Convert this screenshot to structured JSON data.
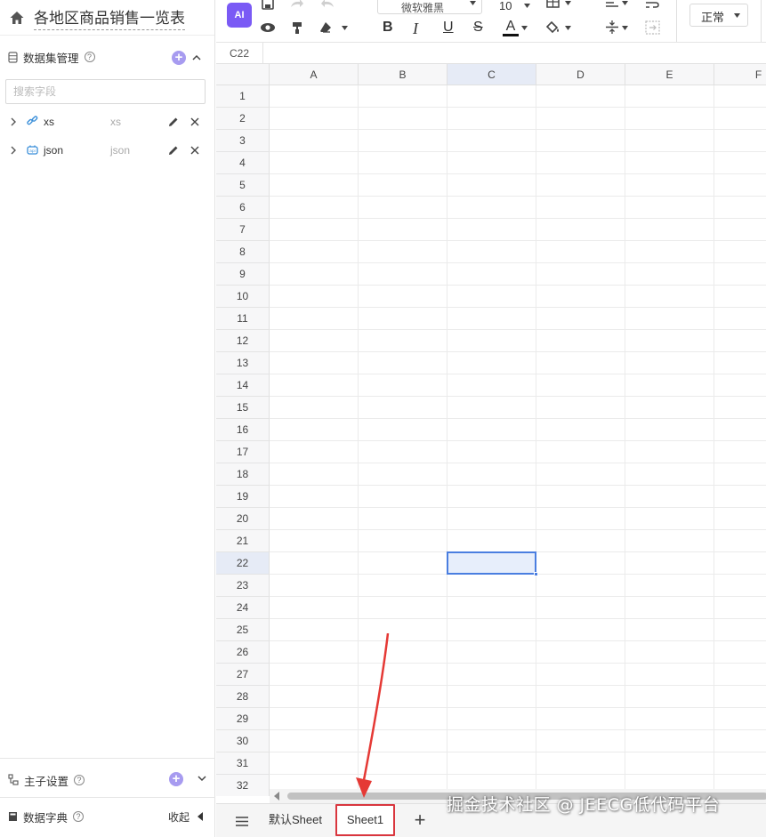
{
  "sidebar": {
    "title": "各地区商品销售一览表",
    "dataset_section": {
      "label": "数据集管理",
      "help": "?"
    },
    "search": {
      "placeholder": "搜索字段"
    },
    "datasets": [
      {
        "name": "xs",
        "type": "xs",
        "icon": "link-icon"
      },
      {
        "name": "json",
        "type": "json",
        "icon": "api-icon"
      }
    ],
    "main_sub": {
      "label": "主子设置",
      "help": "?"
    },
    "dictionary": {
      "label": "数据字典",
      "help": "?",
      "collapse_label": "收起"
    }
  },
  "toolbar": {
    "ai_label": "AI",
    "font_family": "微软雅黑",
    "font_size": "10",
    "bold": "B",
    "italic": "I",
    "underline": "U",
    "strike": "S",
    "font_color_letter": "A",
    "number_format": "正常"
  },
  "namebar": {
    "cell": "C22"
  },
  "grid": {
    "columns": [
      "A",
      "B",
      "C",
      "D",
      "E",
      "F"
    ],
    "rows": [
      "1",
      "2",
      "3",
      "4",
      "5",
      "6",
      "7",
      "8",
      "9",
      "10",
      "11",
      "12",
      "13",
      "14",
      "15",
      "16",
      "17",
      "18",
      "19",
      "20",
      "21",
      "22",
      "23",
      "24",
      "25",
      "26",
      "27",
      "28",
      "29",
      "30",
      "31",
      "32"
    ],
    "active_column": "C",
    "active_row": "22"
  },
  "tabs": {
    "items": [
      "默认Sheet",
      "Sheet1"
    ],
    "active": "Sheet1",
    "add": "+"
  },
  "watermark": "掘金技术社区 @ JEECG低代码平台",
  "colors": {
    "accent": "#7a5af5",
    "selection": "#4a7ee0",
    "annotation": "#e53935"
  }
}
